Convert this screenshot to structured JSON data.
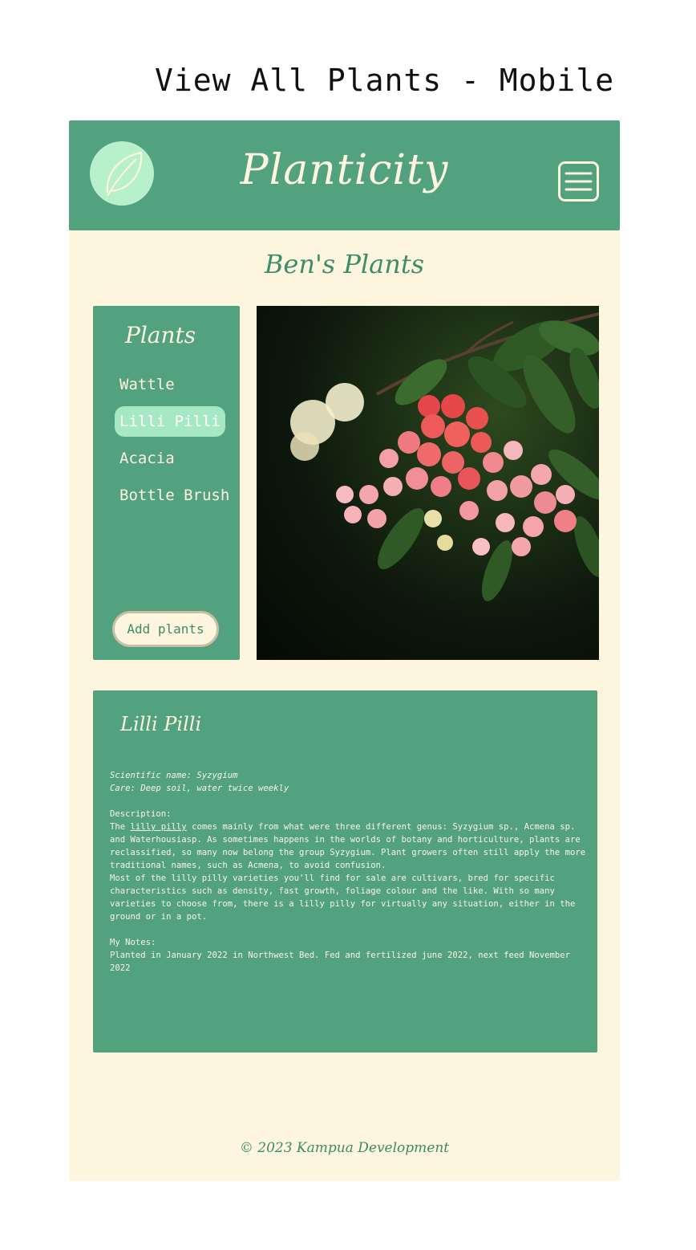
{
  "page_heading": "View All Plants - Mobile",
  "header": {
    "brand": "Planticity",
    "logo_icon": "leaf-icon",
    "menu_icon": "hamburger-menu-icon"
  },
  "owner_title": "Ben's Plants",
  "sidebar": {
    "title": "Plants",
    "items": [
      {
        "label": "Wattle",
        "active": false
      },
      {
        "label": "Lilli Pilli",
        "active": true
      },
      {
        "label": "Acacia",
        "active": false
      },
      {
        "label": "Bottle Brush",
        "active": false
      }
    ],
    "add_button": "Add plants"
  },
  "detail": {
    "title": "Lilli Pilli",
    "scientific_line": "Scientific name: Syzygium",
    "care_line": "Care: Deep soil, water twice weekly",
    "description_label": "Description:",
    "description_prefix": "The",
    "description_link": "lilly pilly",
    "description_p1_rest": "comes mainly from what were three different genus: Syzygium sp., Acmena sp. and Waterhousiasp. As sometimes happens in the worlds of botany and horticulture, plants are reclassified, so many now belong the group Syzygium. Plant growers often still apply the more traditional names, such as Acmena, to avoid confusion.",
    "description_p2": "Most of the lilly pilly varieties you'll find for sale are cultivars, bred for specific characteristics such as density, fast growth, foliage colour and the like. With so many varieties to choose from, there is a lilly pilly for virtually any situation, either in the ground or in a pot.",
    "notes_label": "My Notes:",
    "notes": "Planted in January 2022 in Northwest Bed. Fed and fertilized june 2022, next feed November 2022"
  },
  "footer": "© 2023 Kampua Development",
  "colors": {
    "primary_green": "#52a17f",
    "cream": "#fdf5de",
    "mint": "#b6f1cb",
    "highlight": "#a5e8c3",
    "title_green": "#3c8d6a"
  }
}
